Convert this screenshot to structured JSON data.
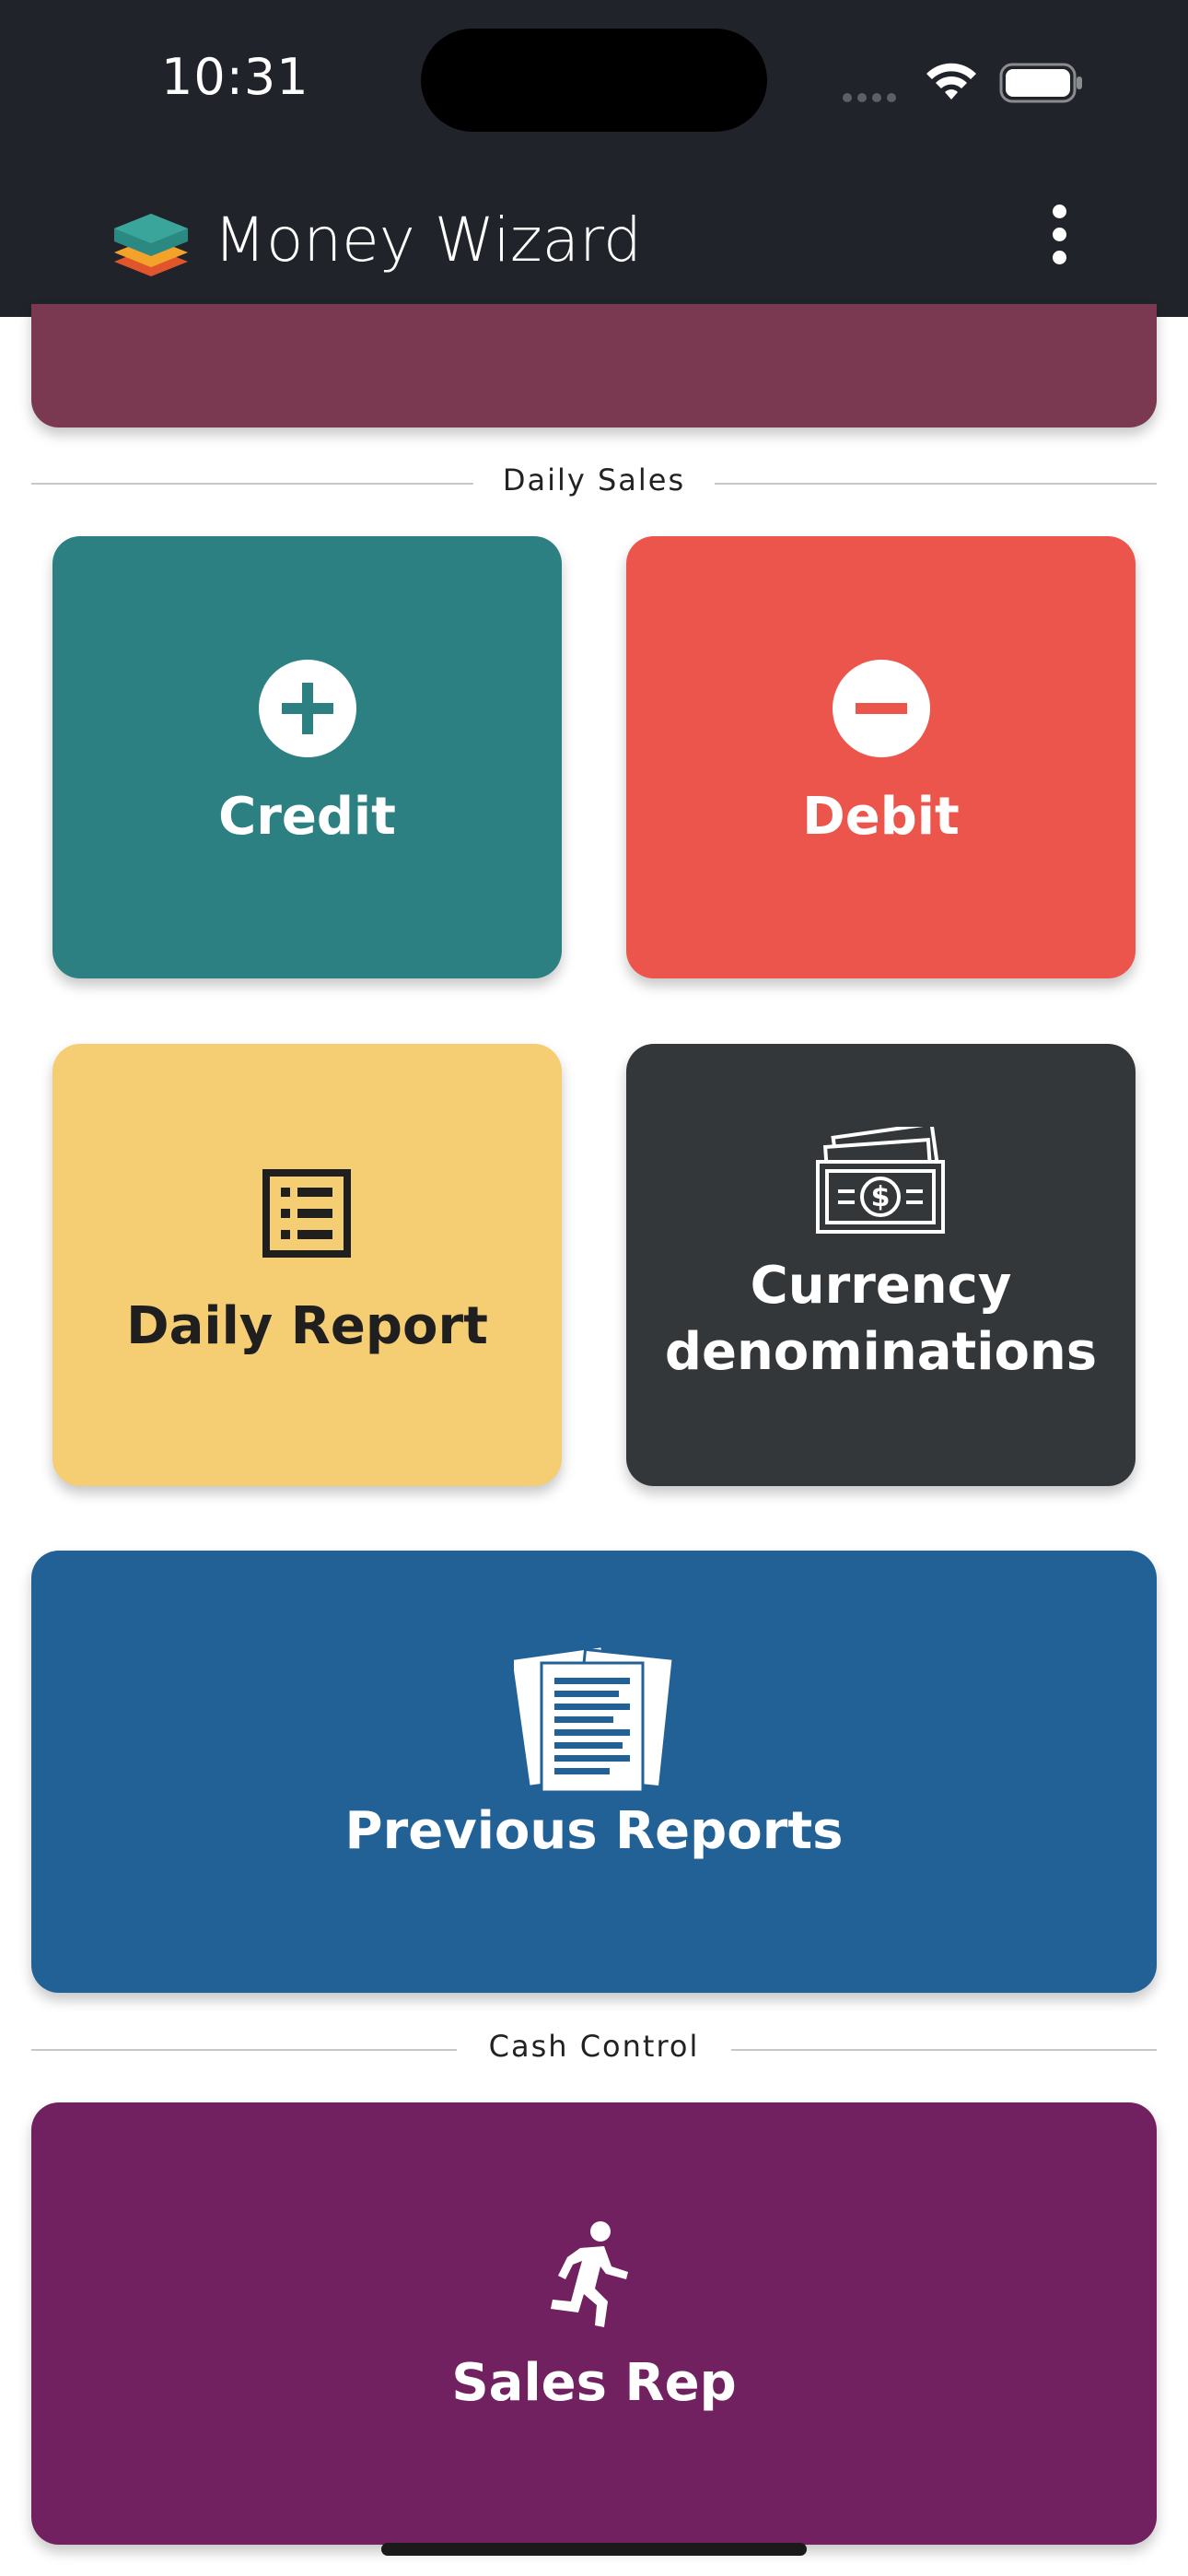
{
  "status_bar": {
    "time": "10:31"
  },
  "app_bar": {
    "title": "Money Wizard"
  },
  "sections": {
    "daily_sales": "Daily Sales",
    "cash_control": "Cash Control"
  },
  "tiles": {
    "credit": {
      "label": "Credit",
      "icon": "plus-circle-icon",
      "color": "#2d8082"
    },
    "debit": {
      "label": "Debit",
      "icon": "minus-circle-icon",
      "color": "#ec554b"
    },
    "daily_report": {
      "label": "Daily Report",
      "icon": "list-icon",
      "color": "#f5cd72"
    },
    "currency": {
      "label_line1": "Currency",
      "label_line2": "denominations",
      "icon": "banknotes-icon",
      "color": "#343739"
    },
    "previous_reports": {
      "label": "Previous Reports",
      "icon": "documents-icon",
      "color": "#226196"
    },
    "sales_rep": {
      "label": "Sales Rep",
      "icon": "running-person-icon",
      "color": "#71215f"
    }
  },
  "colors": {
    "app_bar": "#21232b",
    "partial_card": "#7a3951"
  }
}
